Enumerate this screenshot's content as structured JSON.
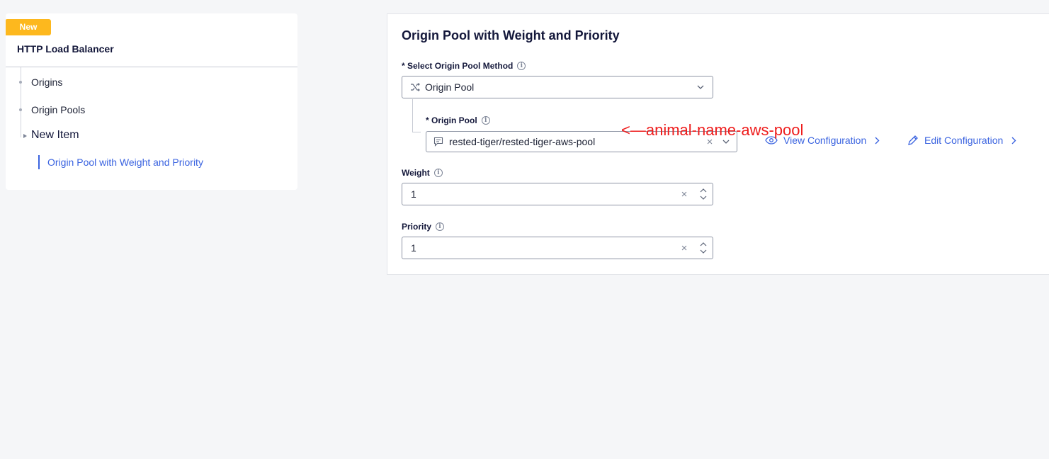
{
  "nav": {
    "badge": "New",
    "title": "HTTP Load Balancer",
    "items": [
      {
        "label": "Origins"
      },
      {
        "label": "Origin Pools"
      },
      {
        "label": "New Item"
      }
    ],
    "active_sub": "Origin Pool with Weight and Priority"
  },
  "panel": {
    "title": "Origin Pool with Weight and Priority",
    "method_label": "* Select Origin Pool Method",
    "method_value": "Origin Pool",
    "origin_pool_label": "* Origin Pool",
    "origin_pool_value": "rested-tiger/rested-tiger-aws-pool",
    "view_config": "View Configuration",
    "edit_config": "Edit Configuration",
    "weight_label": "Weight",
    "weight_value": "1",
    "priority_label": "Priority",
    "priority_value": "1"
  },
  "annotation": "<—animal-name-aws-pool",
  "colors": {
    "accent": "#3a63e0",
    "badge": "#fdb81e",
    "annotation": "#ee1c1c"
  }
}
